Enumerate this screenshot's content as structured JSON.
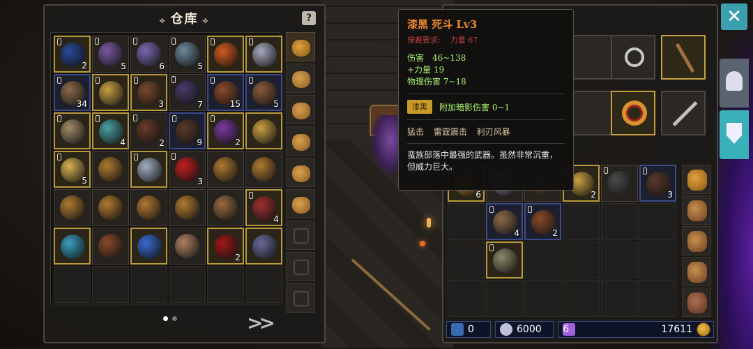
{
  "warehouse": {
    "title": "仓库",
    "help_label": "?",
    "pager_dots": 2,
    "next_label": "»",
    "slots": [
      {
        "c": "gold",
        "lock": true,
        "col": "#2a4a9a",
        "n": "2"
      },
      {
        "c": "plain",
        "lock": true,
        "col": "#7a5aa0",
        "n": "5"
      },
      {
        "c": "plain",
        "lock": true,
        "col": "#7a6ab0",
        "n": "6"
      },
      {
        "c": "plain",
        "lock": true,
        "col": "#6a8a9a",
        "n": "5"
      },
      {
        "c": "gold",
        "lock": true,
        "col": "#d05a20",
        "n": ""
      },
      {
        "c": "gold",
        "lock": true,
        "col": "#a8a8c0",
        "n": ""
      },
      {
        "c": "blue",
        "lock": true,
        "col": "#8a6a4a",
        "n": "34"
      },
      {
        "c": "gold",
        "lock": true,
        "col": "#c8a040",
        "n": ""
      },
      {
        "c": "gold",
        "lock": true,
        "col": "#7a4a2a",
        "n": "3"
      },
      {
        "c": "plain",
        "lock": true,
        "col": "#4a3a6a",
        "n": "7"
      },
      {
        "c": "blue",
        "lock": true,
        "col": "#8a4a2a",
        "n": "15"
      },
      {
        "c": "blue",
        "lock": true,
        "col": "#8a5a3a",
        "n": "5"
      },
      {
        "c": "gold",
        "lock": true,
        "col": "#a08a6a",
        "n": ""
      },
      {
        "c": "gold",
        "lock": true,
        "col": "#4aa0a0",
        "n": "4"
      },
      {
        "c": "plain",
        "lock": true,
        "col": "#6a3a2a",
        "n": "2"
      },
      {
        "c": "blue",
        "lock": true,
        "col": "#5a3a2a",
        "n": "9"
      },
      {
        "c": "gold",
        "lock": true,
        "col": "#7a3aa0",
        "n": "2"
      },
      {
        "c": "gold",
        "lock": false,
        "col": "#c8a040",
        "n": ""
      },
      {
        "c": "gold",
        "lock": true,
        "col": "#d8b050",
        "n": "5"
      },
      {
        "c": "plain",
        "lock": false,
        "col": "#b07a30",
        "n": ""
      },
      {
        "c": "gold",
        "lock": true,
        "col": "#a0b0c0",
        "n": ""
      },
      {
        "c": "plain",
        "lock": true,
        "col": "#c02020",
        "n": "3"
      },
      {
        "c": "plain",
        "lock": false,
        "col": "#b07a30",
        "n": ""
      },
      {
        "c": "plain",
        "lock": false,
        "col": "#b07a30",
        "n": ""
      },
      {
        "c": "plain",
        "lock": false,
        "col": "#b07a30",
        "n": ""
      },
      {
        "c": "plain",
        "lock": false,
        "col": "#b07a30",
        "n": ""
      },
      {
        "c": "plain",
        "lock": false,
        "col": "#b07a30",
        "n": ""
      },
      {
        "c": "plain",
        "lock": false,
        "col": "#b07a30",
        "n": ""
      },
      {
        "c": "plain",
        "lock": false,
        "col": "#9a6a40",
        "n": ""
      },
      {
        "c": "gold",
        "lock": true,
        "col": "#a03030",
        "n": "4"
      },
      {
        "c": "gold",
        "lock": false,
        "col": "#3aa0c0",
        "n": ""
      },
      {
        "c": "plain",
        "lock": false,
        "col": "#8a4a2a",
        "n": ""
      },
      {
        "c": "gold",
        "lock": false,
        "col": "#3a6ad0",
        "n": ""
      },
      {
        "c": "plain",
        "lock": false,
        "col": "#b08060",
        "n": ""
      },
      {
        "c": "gold",
        "lock": false,
        "col": "#a01818",
        "n": "2"
      },
      {
        "c": "gold",
        "lock": false,
        "col": "#6a6a9a",
        "n": ""
      },
      {
        "c": "empty"
      },
      {
        "c": "empty"
      },
      {
        "c": "empty"
      },
      {
        "c": "empty"
      },
      {
        "c": "empty"
      },
      {
        "c": "empty"
      }
    ],
    "bags": [
      "active",
      "bag",
      "bag",
      "bag",
      "bag",
      "bag",
      "empty",
      "empty",
      "empty"
    ]
  },
  "tooltip": {
    "name": "漆黑 死斗 Lv3",
    "req_label": "穿戴要求:",
    "req_value": "力量 67",
    "stat1": "伤害　46~138",
    "stat2": "+力量 19",
    "stat3": "物理伤害 7~18",
    "set_tag": "漆黑",
    "set_effect": "附加暗影伤害 0~1",
    "skills": "猛击 雷霆震击 利刃风暴",
    "desc": "蛮族部落中最强的武器。虽然非常沉重，但威力巨大。"
  },
  "inventory": {
    "counts": [
      "6",
      "2",
      "3",
      "4",
      "2"
    ],
    "currency": {
      "c1": "0",
      "c2": "6000",
      "c3": "6",
      "gold": "17611"
    }
  },
  "close_label": "✕"
}
